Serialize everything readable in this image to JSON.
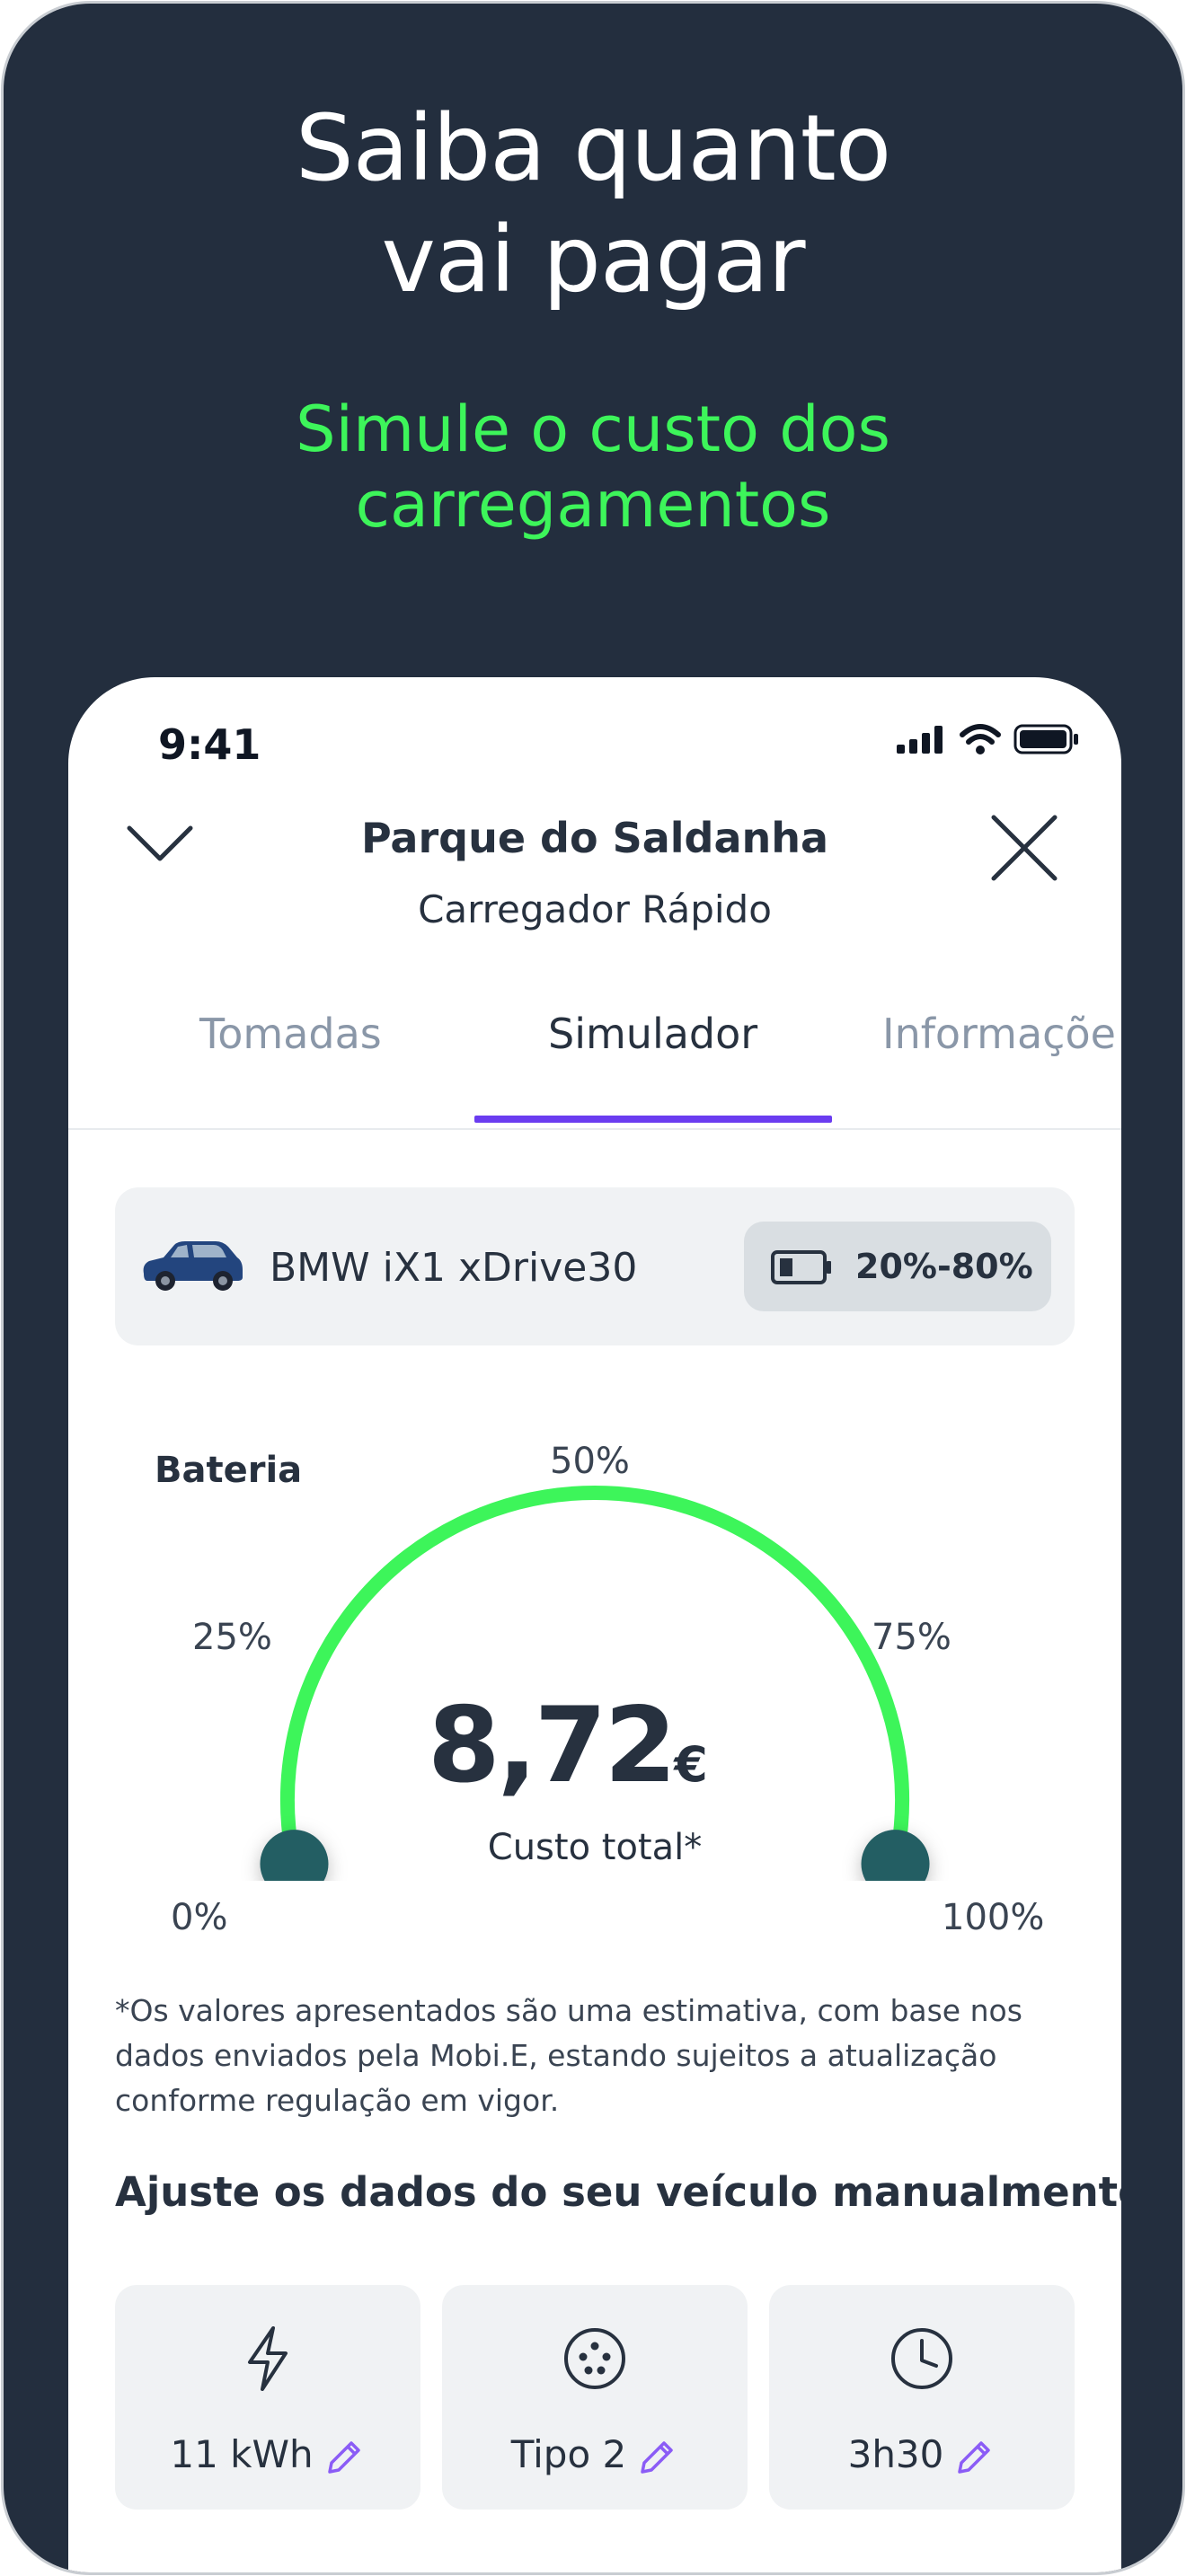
{
  "promo": {
    "headline_line1": "Saiba quanto",
    "headline_line2": "vai pagar",
    "subline_line1": "Simule o custo dos",
    "subline_line2": "carregamentos"
  },
  "status_bar": {
    "time": "9:41"
  },
  "nav": {
    "title": "Parque do Saldanha",
    "subtitle": "Carregador Rápido",
    "back_icon": "chevron-down-icon",
    "close_icon": "close-icon"
  },
  "tabs": [
    {
      "label": "Tomadas",
      "active": false
    },
    {
      "label": "Simulador",
      "active": true
    },
    {
      "label": "Informaçõe",
      "active": false
    }
  ],
  "vehicle": {
    "name": "BMW iX1 xDrive30",
    "battery_range": "20%-80%"
  },
  "gauge": {
    "title": "Bateria",
    "labels": {
      "p0": "0%",
      "p25": "25%",
      "p50": "50%",
      "p75": "75%",
      "p100": "100%"
    },
    "range_start_fraction": 0.2,
    "range_end_fraction": 0.8,
    "cost_value": "8,72",
    "cost_currency": "€",
    "cost_label": "Custo total*",
    "colors": {
      "active": "#3df55a",
      "track": "#d5dcdf",
      "handle": "#235e63"
    }
  },
  "disclaimer": "*Os valores apresentados são uma estimativa, com base nos dados enviados pela Mobi.E, estando sujeitos a atualização conforme regulação em vigor.",
  "manual_section": {
    "title": "Ajuste os dados do seu veículo manualmente",
    "params": [
      {
        "icon": "lightning-icon",
        "value": "11 kWh"
      },
      {
        "icon": "plug-type-icon",
        "value": "Tipo 2"
      },
      {
        "icon": "clock-icon",
        "value": "3h30"
      }
    ]
  },
  "colors": {
    "background_dark": "#232e3e",
    "accent_green": "#3df55a",
    "tab_underline": "#6a3cf0",
    "edit_pencil": "#8b5cf6"
  }
}
